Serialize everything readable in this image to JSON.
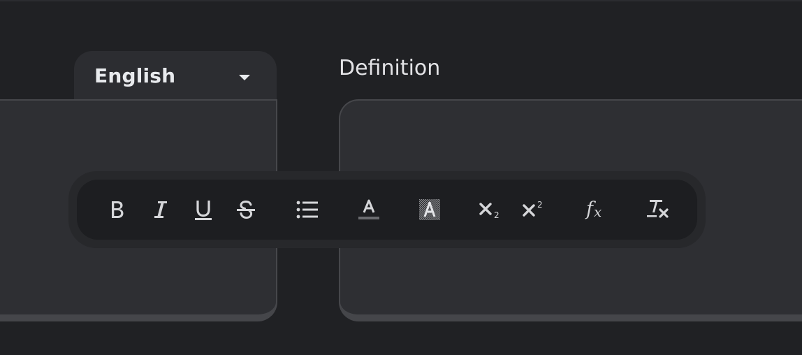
{
  "language_selector": {
    "selected": "English",
    "caret_icon": "caret-down-icon"
  },
  "definition": {
    "label": "Definition"
  },
  "toolbar": {
    "buttons": [
      {
        "name": "bold",
        "icon": "bold-icon"
      },
      {
        "name": "italic",
        "icon": "italic-icon"
      },
      {
        "name": "underline",
        "icon": "underline-icon"
      },
      {
        "name": "strikethrough",
        "icon": "strikethrough-icon"
      },
      {
        "name": "bulleted-list",
        "icon": "list-icon"
      },
      {
        "name": "text-color",
        "icon": "text-color-icon"
      },
      {
        "name": "highlight",
        "icon": "highlight-icon"
      },
      {
        "name": "subscript",
        "icon": "subscript-icon"
      },
      {
        "name": "superscript",
        "icon": "superscript-icon"
      },
      {
        "name": "formula",
        "icon": "formula-icon"
      },
      {
        "name": "clear-formatting",
        "icon": "clear-format-icon"
      }
    ]
  },
  "colors": {
    "background": "#202124",
    "panel": "#2e2f33",
    "toolbar": "#1d1e21",
    "icon": "#d5d6d9"
  }
}
